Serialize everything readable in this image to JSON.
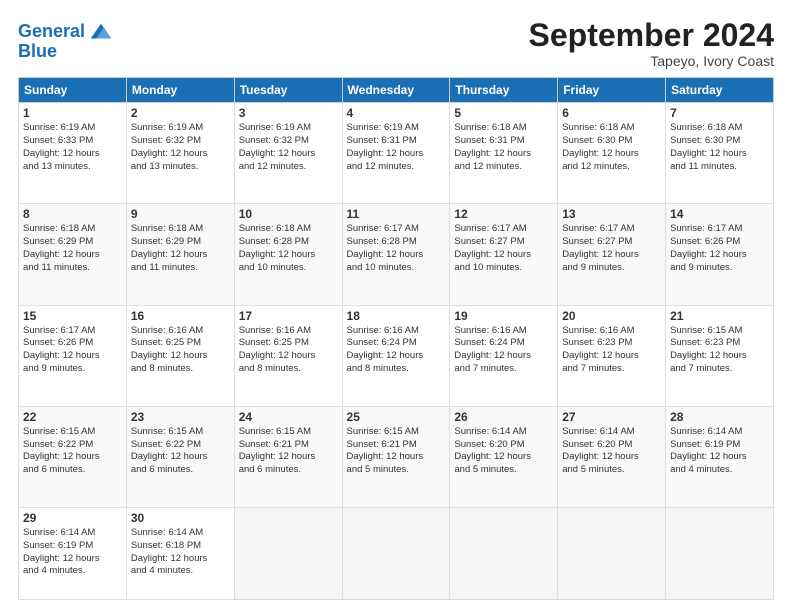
{
  "logo": {
    "line1": "General",
    "line2": "Blue"
  },
  "title": "September 2024",
  "subtitle": "Tapeyo, Ivory Coast",
  "days_of_week": [
    "Sunday",
    "Monday",
    "Tuesday",
    "Wednesday",
    "Thursday",
    "Friday",
    "Saturday"
  ],
  "weeks": [
    [
      {
        "day": 1,
        "info": "Sunrise: 6:19 AM\nSunset: 6:33 PM\nDaylight: 12 hours\nand 13 minutes."
      },
      {
        "day": 2,
        "info": "Sunrise: 6:19 AM\nSunset: 6:32 PM\nDaylight: 12 hours\nand 13 minutes."
      },
      {
        "day": 3,
        "info": "Sunrise: 6:19 AM\nSunset: 6:32 PM\nDaylight: 12 hours\nand 12 minutes."
      },
      {
        "day": 4,
        "info": "Sunrise: 6:19 AM\nSunset: 6:31 PM\nDaylight: 12 hours\nand 12 minutes."
      },
      {
        "day": 5,
        "info": "Sunrise: 6:18 AM\nSunset: 6:31 PM\nDaylight: 12 hours\nand 12 minutes."
      },
      {
        "day": 6,
        "info": "Sunrise: 6:18 AM\nSunset: 6:30 PM\nDaylight: 12 hours\nand 12 minutes."
      },
      {
        "day": 7,
        "info": "Sunrise: 6:18 AM\nSunset: 6:30 PM\nDaylight: 12 hours\nand 11 minutes."
      }
    ],
    [
      {
        "day": 8,
        "info": "Sunrise: 6:18 AM\nSunset: 6:29 PM\nDaylight: 12 hours\nand 11 minutes."
      },
      {
        "day": 9,
        "info": "Sunrise: 6:18 AM\nSunset: 6:29 PM\nDaylight: 12 hours\nand 11 minutes."
      },
      {
        "day": 10,
        "info": "Sunrise: 6:18 AM\nSunset: 6:28 PM\nDaylight: 12 hours\nand 10 minutes."
      },
      {
        "day": 11,
        "info": "Sunrise: 6:17 AM\nSunset: 6:28 PM\nDaylight: 12 hours\nand 10 minutes."
      },
      {
        "day": 12,
        "info": "Sunrise: 6:17 AM\nSunset: 6:27 PM\nDaylight: 12 hours\nand 10 minutes."
      },
      {
        "day": 13,
        "info": "Sunrise: 6:17 AM\nSunset: 6:27 PM\nDaylight: 12 hours\nand 9 minutes."
      },
      {
        "day": 14,
        "info": "Sunrise: 6:17 AM\nSunset: 6:26 PM\nDaylight: 12 hours\nand 9 minutes."
      }
    ],
    [
      {
        "day": 15,
        "info": "Sunrise: 6:17 AM\nSunset: 6:26 PM\nDaylight: 12 hours\nand 9 minutes."
      },
      {
        "day": 16,
        "info": "Sunrise: 6:16 AM\nSunset: 6:25 PM\nDaylight: 12 hours\nand 8 minutes."
      },
      {
        "day": 17,
        "info": "Sunrise: 6:16 AM\nSunset: 6:25 PM\nDaylight: 12 hours\nand 8 minutes."
      },
      {
        "day": 18,
        "info": "Sunrise: 6:16 AM\nSunset: 6:24 PM\nDaylight: 12 hours\nand 8 minutes."
      },
      {
        "day": 19,
        "info": "Sunrise: 6:16 AM\nSunset: 6:24 PM\nDaylight: 12 hours\nand 7 minutes."
      },
      {
        "day": 20,
        "info": "Sunrise: 6:16 AM\nSunset: 6:23 PM\nDaylight: 12 hours\nand 7 minutes."
      },
      {
        "day": 21,
        "info": "Sunrise: 6:15 AM\nSunset: 6:23 PM\nDaylight: 12 hours\nand 7 minutes."
      }
    ],
    [
      {
        "day": 22,
        "info": "Sunrise: 6:15 AM\nSunset: 6:22 PM\nDaylight: 12 hours\nand 6 minutes."
      },
      {
        "day": 23,
        "info": "Sunrise: 6:15 AM\nSunset: 6:22 PM\nDaylight: 12 hours\nand 6 minutes."
      },
      {
        "day": 24,
        "info": "Sunrise: 6:15 AM\nSunset: 6:21 PM\nDaylight: 12 hours\nand 6 minutes."
      },
      {
        "day": 25,
        "info": "Sunrise: 6:15 AM\nSunset: 6:21 PM\nDaylight: 12 hours\nand 5 minutes."
      },
      {
        "day": 26,
        "info": "Sunrise: 6:14 AM\nSunset: 6:20 PM\nDaylight: 12 hours\nand 5 minutes."
      },
      {
        "day": 27,
        "info": "Sunrise: 6:14 AM\nSunset: 6:20 PM\nDaylight: 12 hours\nand 5 minutes."
      },
      {
        "day": 28,
        "info": "Sunrise: 6:14 AM\nSunset: 6:19 PM\nDaylight: 12 hours\nand 4 minutes."
      }
    ],
    [
      {
        "day": 29,
        "info": "Sunrise: 6:14 AM\nSunset: 6:19 PM\nDaylight: 12 hours\nand 4 minutes."
      },
      {
        "day": 30,
        "info": "Sunrise: 6:14 AM\nSunset: 6:18 PM\nDaylight: 12 hours\nand 4 minutes."
      },
      {
        "day": null
      },
      {
        "day": null
      },
      {
        "day": null
      },
      {
        "day": null
      },
      {
        "day": null
      }
    ]
  ]
}
